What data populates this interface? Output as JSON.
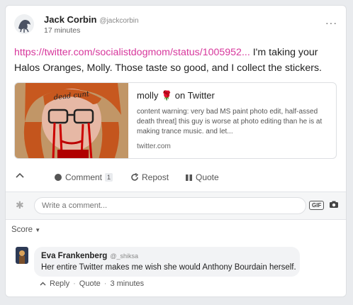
{
  "post": {
    "author_name": "Jack Corbin",
    "author_handle": "@jackcorbin",
    "time": "17 minutes",
    "more_label": "···",
    "link_text": "https://twitter.com/socialistdogmom/status/1005952...",
    "body_text": " I'm taking your Halos Oranges, Molly. Those taste so good, and I collect the stickers."
  },
  "link_card": {
    "thumb_caption": "dead cunt",
    "title": "molly 🌹 on Twitter",
    "description": "content warning: very bad MS paint photo edit, half-assed death threat] this guy is worse at photo editing than he is at making trance music. and let...",
    "url": "twitter.com"
  },
  "actions": {
    "comment_label": "Comment",
    "comment_count": "1",
    "repost_label": "Repost",
    "quote_label": "Quote"
  },
  "composer": {
    "placeholder": "Write a comment...",
    "gif_label": "GIF"
  },
  "sort": {
    "label": "Score"
  },
  "comment": {
    "author_name": "Eva Frankenberg",
    "author_handle": "@_shiksa",
    "text": "Her entire Twitter makes me wish she would Anthony Bourdain herself.",
    "reply_label": "Reply",
    "quote_label": "Quote",
    "time": "3 minutes"
  },
  "colors": {
    "link": "#d7379c",
    "page_bg": "#e9ebee"
  }
}
